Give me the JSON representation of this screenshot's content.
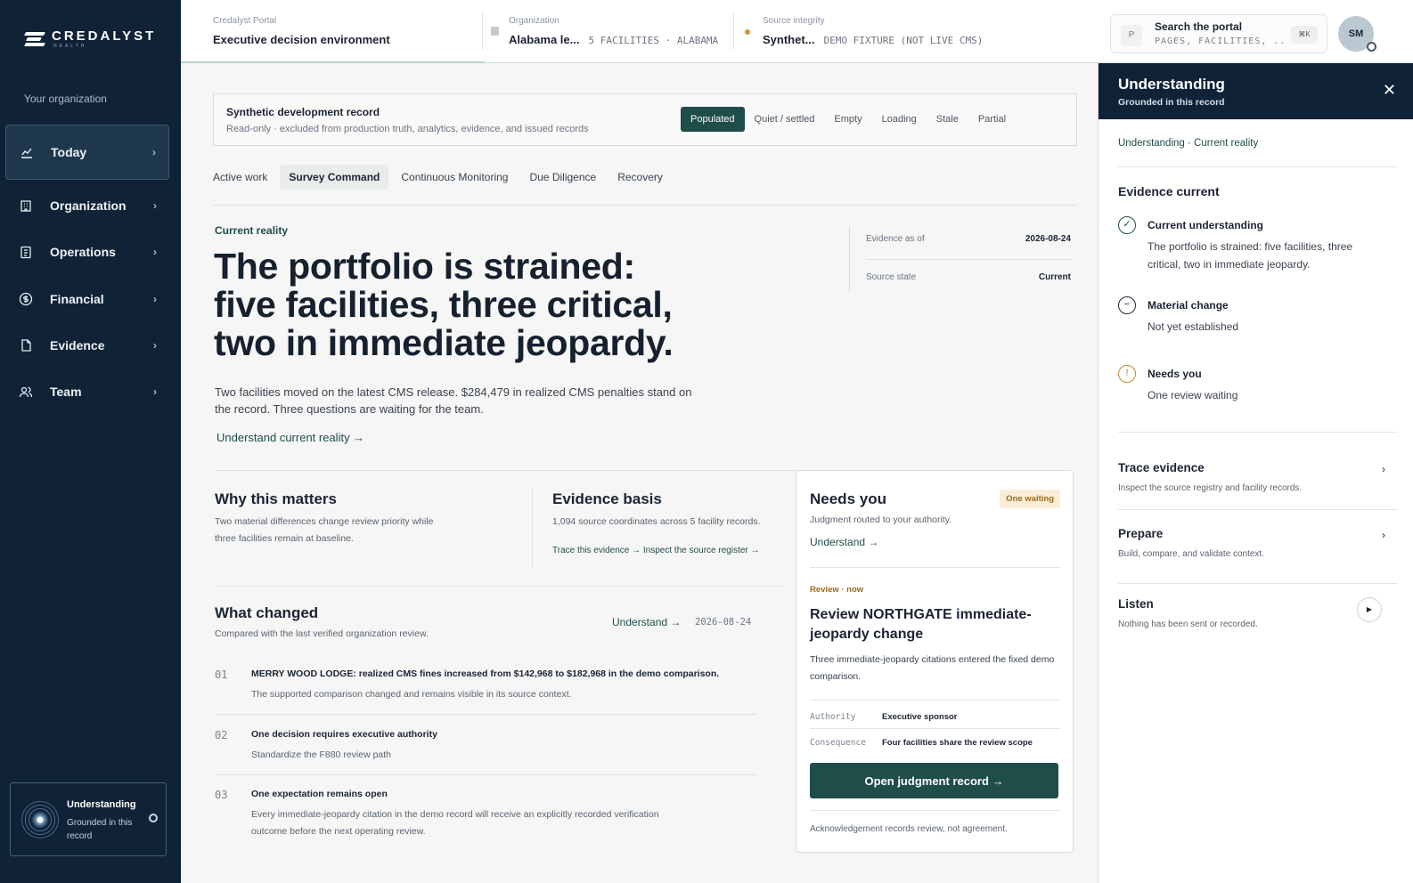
{
  "sidebar": {
    "brand": "CREDALYST",
    "brand_sub": "HEALTH",
    "org_label": "Your organization",
    "items": [
      {
        "label": "Today",
        "icon": "chart-icon"
      },
      {
        "label": "Organization",
        "icon": "building-icon"
      },
      {
        "label": "Operations",
        "icon": "clipboard-icon"
      },
      {
        "label": "Financial",
        "icon": "dollar-icon"
      },
      {
        "label": "Evidence",
        "icon": "document-icon"
      },
      {
        "label": "Team",
        "icon": "people-icon"
      }
    ],
    "understanding": {
      "title": "Understanding",
      "subtitle": "Grounded in this record"
    }
  },
  "topbar": {
    "portal_label": "Credalyst Portal",
    "portal_title": "Executive decision environment",
    "org_label": "Organization",
    "org_name": "Alabama le...",
    "org_meta": "5 FACILITIES · ALABAMA",
    "source_label": "Source integrity",
    "source_name": "Synthet...",
    "source_meta": "DEMO FIXTURE (NOT LIVE CMS)",
    "search_title": "Search the portal",
    "search_hint": "PAGES, FACILITIES, ..",
    "search_kbd": "⌘K",
    "search_icon": "P",
    "avatar": "SM"
  },
  "banner": {
    "title": "Synthetic development record",
    "subtitle": "Read-only · excluded from production truth, analytics, evidence, and issued records",
    "states": [
      "Populated",
      "Quiet / settled",
      "Empty",
      "Loading",
      "Stale",
      "Partial"
    ],
    "active_state": "Populated"
  },
  "tabs": [
    "Active work",
    "Survey Command",
    "Continuous Monitoring",
    "Due Diligence",
    "Recovery"
  ],
  "active_tab": "Survey Command",
  "current_reality": {
    "label": "Current reality",
    "headline_lines": [
      "The portfolio is strained:",
      "five facilities, three critical,",
      "two in immediate jeopardy."
    ],
    "lede": "Two facilities moved on the latest CMS release. $284,479 in realized CMS penalties stand on the record. Three questions are waiting for the team.",
    "link": "Understand current reality →",
    "evidence_as_of_label": "Evidence as of",
    "evidence_as_of": "2026-08-24",
    "source_state_label": "Source state",
    "source_state": "Current"
  },
  "why": {
    "title": "Why this matters",
    "body": "Two material differences change review priority while three facilities remain at baseline."
  },
  "basis": {
    "title": "Evidence basis",
    "body": "1,094 source coordinates across 5 facility records.",
    "link1": "Trace this evidence →",
    "link2": "Inspect the source register →"
  },
  "what_changed": {
    "title": "What changed",
    "subtitle": "Compared with the last verified organization review.",
    "link": "Understand →",
    "date": "2026-08-24",
    "items": [
      {
        "num": "01",
        "title": "MERRY WOOD LODGE: realized CMS fines increased from $142,968 to $182,968 in the demo comparison.",
        "desc": "The supported comparison changed and remains visible in its source context."
      },
      {
        "num": "02",
        "title": "One decision requires executive authority",
        "desc": "Standardize the F880 review path"
      },
      {
        "num": "03",
        "title": "One expectation remains open",
        "desc": "Every immediate-jeopardy citation in the demo record will receive an explicitly recorded verification outcome before the next operating review."
      }
    ]
  },
  "needs_you": {
    "title": "Needs you",
    "badge": "One waiting",
    "subtitle": "Judgment routed to your authority.",
    "link": "Understand →",
    "review_tag": "Review · now",
    "review_title": "Review NORTHGATE immediate-jeopardy change",
    "review_desc": "Three immediate-jeopardy citations entered the fixed demo comparison.",
    "authority_label": "Authority",
    "authority": "Executive sponsor",
    "consequence_label": "Consequence",
    "consequence": "Four facilities share the review scope",
    "button": "Open judgment record",
    "ack": "Acknowledgement records review, not agreement."
  },
  "panel": {
    "title": "Understanding",
    "subtitle": "Grounded in this record",
    "crumb": "Understanding · Current reality",
    "section": "Evidence current",
    "items": [
      {
        "title": "Current understanding",
        "desc": "The portfolio is strained: five facilities, three critical, two in immediate jeopardy.",
        "icon": "check-icon",
        "glyph": "✓"
      },
      {
        "title": "Material change",
        "desc": "Not yet established",
        "icon": "minus-icon",
        "glyph": "−"
      },
      {
        "title": "Needs you",
        "desc": "One review waiting",
        "icon": "alert-icon",
        "glyph": "!"
      }
    ],
    "actions": [
      {
        "title": "Trace evidence",
        "desc": "Inspect the source registry and facility records."
      },
      {
        "title": "Prepare",
        "desc": "Build, compare, and validate context."
      },
      {
        "title": "Listen",
        "desc": "Nothing has been sent or recorded."
      }
    ]
  },
  "colors": {
    "navy": "#0f2236",
    "teal": "#1f4d4a",
    "amber": "#9a6a1e"
  }
}
